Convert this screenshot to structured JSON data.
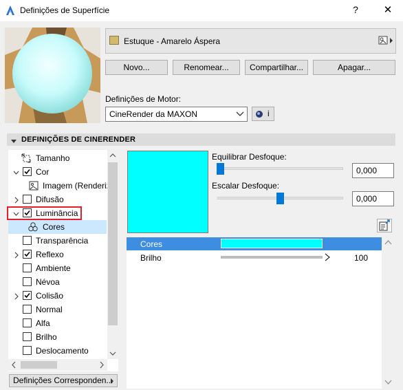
{
  "window": {
    "title": "Definições de Superfície",
    "help_label": "?",
    "close_label": "✕"
  },
  "material": {
    "name": "Estuque - Amarelo Áspera",
    "swatch_color": "#d3b96e"
  },
  "buttons": {
    "new": "Novo...",
    "rename": "Renomear...",
    "share": "Compartilhar...",
    "delete": "Apagar..."
  },
  "engine": {
    "label": "Definições de Motor:",
    "selected": "CineRender da MAXON",
    "info_label": "i"
  },
  "section": {
    "title": "DEFINIÇÕES DE CINERENDER"
  },
  "tree": {
    "items": [
      {
        "label": "Tamanho"
      },
      {
        "label": "Cor"
      },
      {
        "label": "Imagem (Renderiz"
      },
      {
        "label": "Difusão"
      },
      {
        "label": "Luminância"
      },
      {
        "label": "Cores"
      },
      {
        "label": "Transparência"
      },
      {
        "label": "Reflexo"
      },
      {
        "label": "Ambiente"
      },
      {
        "label": "Névoa"
      },
      {
        "label": "Colisão"
      },
      {
        "label": "Normal"
      },
      {
        "label": "Alfa"
      },
      {
        "label": "Brilho"
      },
      {
        "label": "Deslocamento"
      }
    ],
    "matching_button": "Definições Corresponden..."
  },
  "luminance": {
    "color": "#00ffff",
    "blur_balance_label": "Equilibrar Desfoque:",
    "blur_balance_value": "0,000",
    "blur_scale_label": "Escalar Desfoque:",
    "blur_scale_value": "0,000"
  },
  "channels": {
    "rows": [
      {
        "label": "Cores",
        "color": "#00ffff"
      },
      {
        "label": "Brilho",
        "value": "100"
      }
    ]
  },
  "colors": {
    "accent": "#0078d7",
    "selection": "#3d8ee0",
    "highlight_border": "#e0202a"
  }
}
